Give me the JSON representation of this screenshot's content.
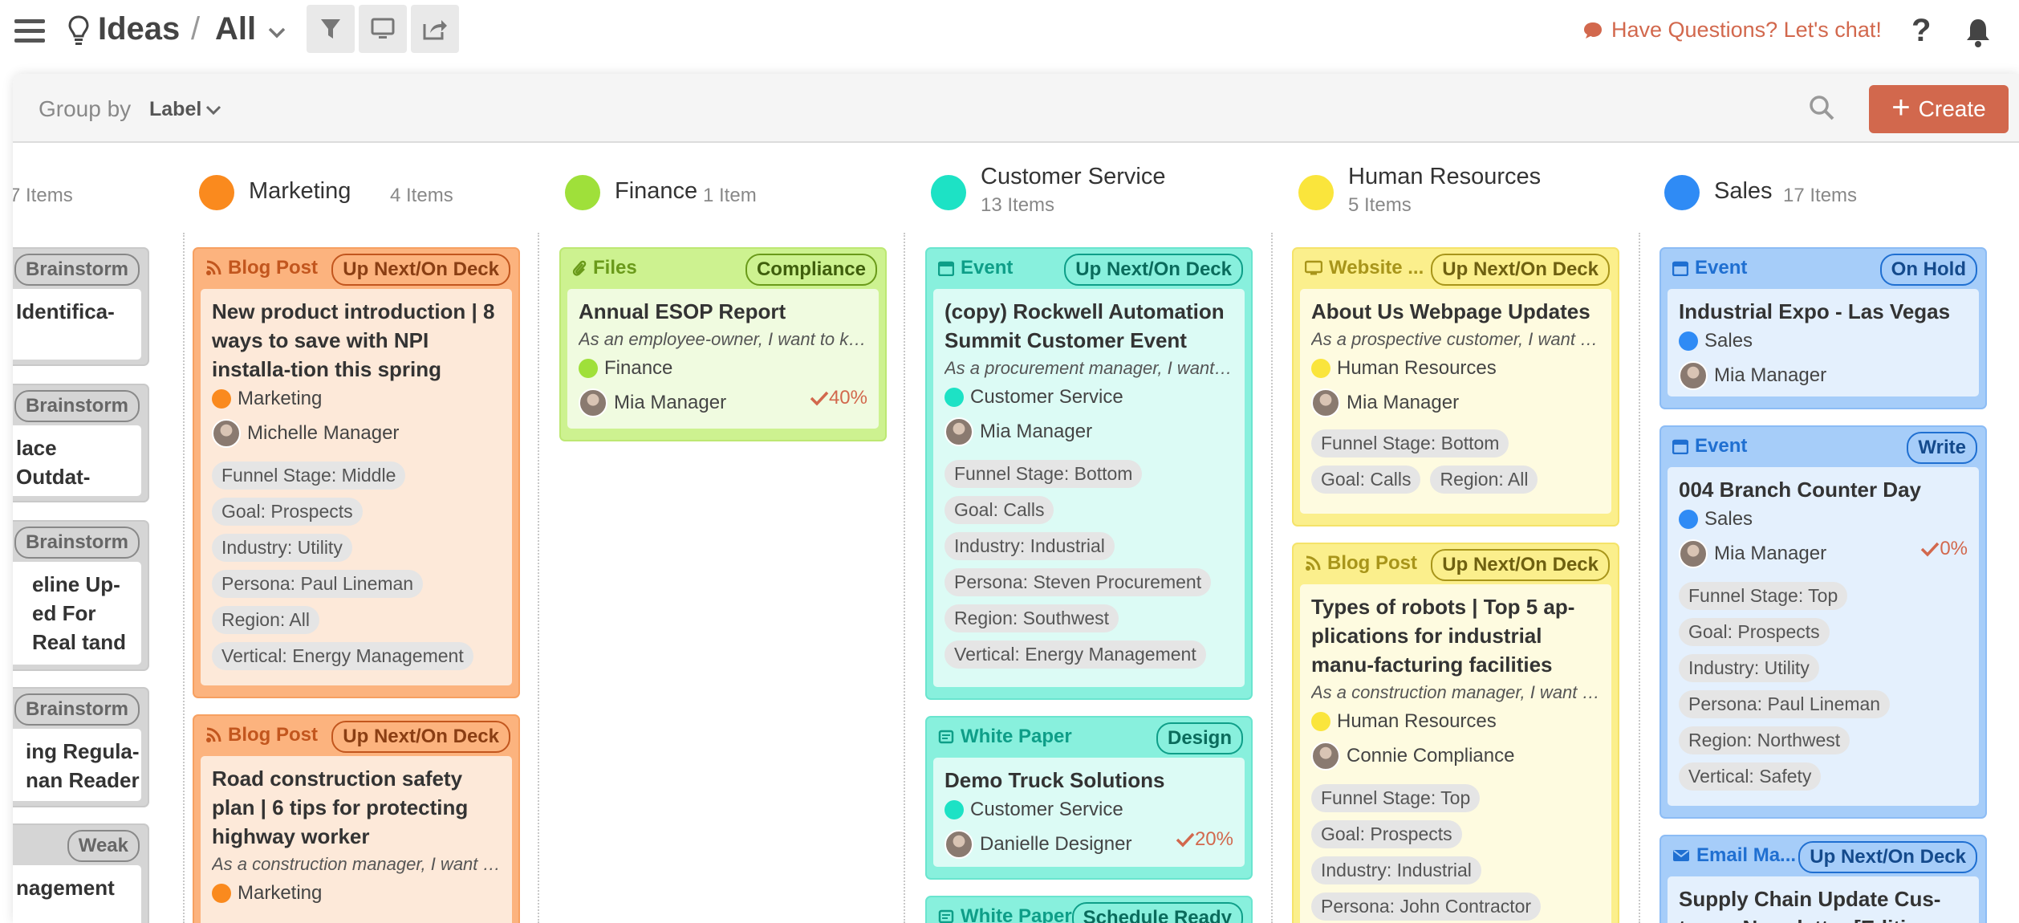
{
  "header": {
    "breadcrumb_ideas": "Ideas",
    "breadcrumb_sep": "/",
    "breadcrumb_all": "All",
    "chat_link": "Have Questions? Let's chat!",
    "help": "?"
  },
  "toolbar": {
    "groupby_label": "Group by",
    "groupby_value": "Label",
    "create_label": "Create"
  },
  "colors": {
    "accent": "#d2684d",
    "marketing": "#fa8a1e",
    "finance": "#9fe03a",
    "customer_service": "#1de2c5",
    "human_resources": "#fae53c",
    "sales": "#2f8bf5",
    "gray": "#b8b8b8"
  },
  "columns": [
    {
      "title": "",
      "count": "7 Items",
      "cards": [
        {
          "status": "Brainstorm",
          "title": "Identifica-"
        },
        {
          "status": "Brainstorm",
          "title": "lace Outdat-"
        },
        {
          "status": "Brainstorm",
          "title": "eline Up- ed For Real tand"
        },
        {
          "status": "Brainstorm",
          "title": "ing Regula- nan Reader"
        },
        {
          "status": "Weak",
          "title": "nagement"
        }
      ]
    },
    {
      "title": "Marketing",
      "count": "4 Items",
      "cards": [
        {
          "type": "Blog Post",
          "status": "Up Next/On Deck",
          "title": "New product introduction | 8 ways to save with NPI installa-tion this spring",
          "label": "Marketing",
          "owner": "Michelle Manager",
          "tags": [
            "Funnel Stage: Middle",
            "Goal: Prospects",
            "Industry: Utility",
            "Persona: Paul Lineman",
            "Region: All",
            "Vertical: Energy Management"
          ]
        },
        {
          "type": "Blog Post",
          "status": "Up Next/On Deck",
          "title": "Road construction safety plan | 6 tips for protecting highway worker",
          "desc": "As a construction manager, I want to ensure safety",
          "label": "Marketing"
        }
      ]
    },
    {
      "title": "Finance",
      "count": "1 Item",
      "cards": [
        {
          "type": "Files",
          "status": "Compliance",
          "title": "Annual ESOP Report",
          "desc": "As an employee-owner, I want to know",
          "label": "Finance",
          "owner": "Mia Manager",
          "progress": "40%"
        }
      ]
    },
    {
      "title": "Customer Service",
      "count": "13 Items",
      "cards": [
        {
          "type": "Event",
          "status": "Up Next/On Deck",
          "title": "(copy) Rockwell Automation Summit Customer Event",
          "desc": "As a procurement manager, I want to attend",
          "label": "Customer Service",
          "owner": "Mia Manager",
          "tags": [
            "Funnel Stage: Bottom",
            "Goal: Calls",
            "Industry: Industrial",
            "Persona: Steven Procurement",
            "Region: Southwest",
            "Vertical: Energy Management"
          ]
        },
        {
          "type": "White Paper",
          "status": "Design",
          "title": "Demo Truck Solutions",
          "label": "Customer Service",
          "owner": "Danielle Designer",
          "progress": "20%"
        },
        {
          "type": "White Paper",
          "status": "Schedule Ready"
        }
      ]
    },
    {
      "title": "Human Resources",
      "count": "5 Items",
      "cards": [
        {
          "type": "Website ...",
          "status": "Up Next/On Deck",
          "title": "About Us Webpage Updates",
          "desc": "As a prospective customer, I want to learn",
          "label": "Human Resources",
          "owner": "Mia Manager",
          "tags": [
            "Funnel Stage: Bottom",
            "Goal: Calls",
            "Region: All"
          ]
        },
        {
          "type": "Blog Post",
          "status": "Up Next/On Deck",
          "title": "Types of robots | Top 5 ap-plications for industrial manu-facturing facilities",
          "desc": "As a construction manager, I want to know",
          "label": "Human Resources",
          "owner": "Connie Compliance",
          "tags": [
            "Funnel Stage: Top",
            "Goal: Prospects",
            "Industry: Industrial",
            "Persona: John Contractor"
          ]
        }
      ]
    },
    {
      "title": "Sales",
      "count": "17 Items",
      "cards": [
        {
          "type": "Event",
          "status": "On Hold",
          "title": "Industrial Expo - Las Vegas",
          "label": "Sales",
          "owner": "Mia Manager"
        },
        {
          "type": "Event",
          "status": "Write",
          "title": "004 Branch Counter Day",
          "label": "Sales",
          "owner": "Mia Manager",
          "progress": "0%",
          "tags": [
            "Funnel Stage: Top",
            "Goal: Prospects",
            "Industry: Utility",
            "Persona: Paul Lineman",
            "Region: Northwest",
            "Vertical: Safety"
          ]
        },
        {
          "type": "Email Ma...",
          "status": "Up Next/On Deck",
          "title": "Supply Chain Update Cus-tomer Newsletter [Edition"
        }
      ]
    }
  ]
}
